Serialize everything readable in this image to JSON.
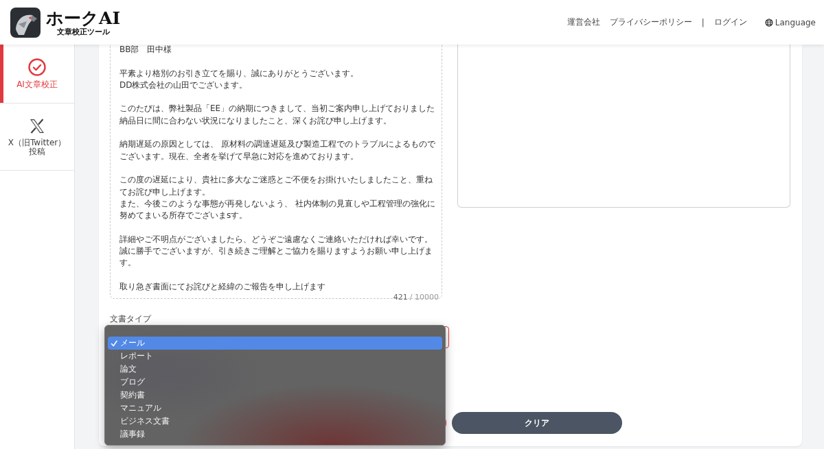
{
  "header": {
    "logo": {
      "title": "ホークAI",
      "subtitle": "文章校正ツール"
    },
    "nav": [
      {
        "kind": "link",
        "label": "運営会社"
      },
      {
        "kind": "link",
        "label": "プライバシーポリシー"
      },
      {
        "kind": "separator",
        "label": "|"
      },
      {
        "kind": "link",
        "label": "ログイン"
      },
      {
        "kind": "language",
        "label": "Language"
      }
    ]
  },
  "sidebar": {
    "items": [
      {
        "kind": "check",
        "label": "AI文章校正",
        "selected": true
      },
      {
        "kind": "x",
        "label": "X（旧Twitter）投稿",
        "selected": false
      }
    ]
  },
  "editor": {
    "paragraphs": [
      [
        "BB部　田中様"
      ],
      [
        "平素より格別のお引き立てを賜り、誠にありがとうございます。",
        "DD株式会社の山田でございます。"
      ],
      [
        "このたびは、弊社製品「EE」の納期につきまして、当初ご案内申し上げておりました納品日に間に合わない状況になりましたこと、深くお詫び申し上げます。"
      ],
      [
        "納期遅延の原因としては、 原材料の調達遅延及び製造工程でのトラブルによるものでございます。現在、全者を挙げて早急に対応を進めております。"
      ],
      [
        "この度の遅延により、貴社に多大なご迷惑とご不便をお掛けいたしましたこと、重ねてお詫び申し上げます。",
        "また、今後このような事態が再発しないよう、 社内体制の見直しや工程管理の強化に努めてまいる所存でございまsす。"
      ],
      [
        "詳細やご不明点がございましたら、どうぞご遠慮なくご連絡いただければ幸いです。誠に勝手でございますが、引き続きご理解とご協力を賜りますようお願い申し上げます。"
      ],
      [
        "取り急ぎ書面にてお詫びと経緯のご報告を申し上げます"
      ]
    ],
    "count": "421",
    "limit": "/ 10000"
  },
  "document_type": {
    "label": "文書タイプ",
    "options": [
      {
        "label": "メール",
        "selected": true
      },
      {
        "label": "レポート",
        "selected": false
      },
      {
        "label": "論文",
        "selected": false
      },
      {
        "label": "ブログ",
        "selected": false
      },
      {
        "label": "契約書",
        "selected": false
      },
      {
        "label": "マニュアル",
        "selected": false
      },
      {
        "label": "ビジネス文書",
        "selected": false
      },
      {
        "label": "議事録",
        "selected": false
      }
    ]
  },
  "buttons": [
    {
      "kind": "primary"
    },
    {
      "kind": "secondary",
      "label": "クリア"
    }
  ]
}
